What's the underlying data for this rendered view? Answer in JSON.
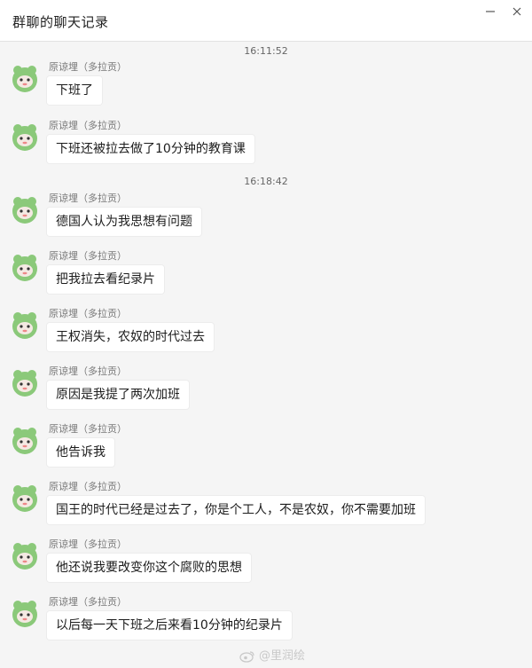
{
  "window": {
    "title": "群聊的聊天记录"
  },
  "timestamps": [
    "16:11:52",
    "16:18:42"
  ],
  "sender": "原谅埋（多拉贡）",
  "messages": [
    "下班了",
    "下班还被拉去做了10分钟的教育课",
    "德国人认为我思想有问题",
    "把我拉去看纪录片",
    "王权消失，农奴的时代过去",
    "原因是我提了两次加班",
    "他告诉我",
    "国王的时代已经是过去了，你是个工人，不是农奴，你不需要加班",
    "他还说我要改变你这个腐败的思想",
    "以后每一天下班之后来看10分钟的纪录片"
  ],
  "watermark": "@里润绘",
  "colors": {
    "avatar": "#8bc97a",
    "background": "#f5f5f5",
    "bubble": "#ffffff"
  }
}
